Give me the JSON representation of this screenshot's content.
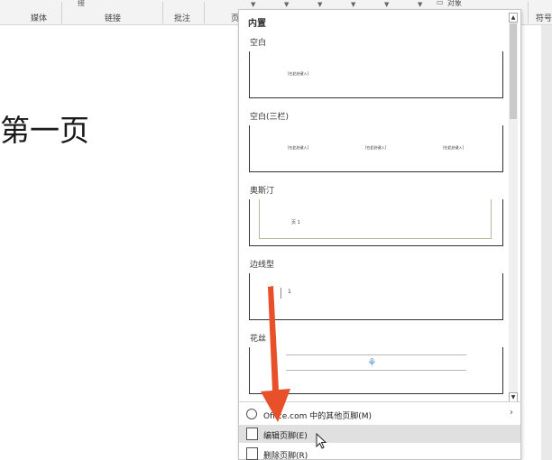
{
  "ribbon": {
    "groups": [
      "媒体",
      "链接",
      "批注",
      "页"
    ],
    "right_label": "符号",
    "fragment_left": "接",
    "fragment_right": "对象"
  },
  "document": {
    "text": "第一页"
  },
  "gallery": {
    "heading": "内置",
    "items": [
      {
        "label": "空白",
        "placeholders": [
          "[在此处键入]"
        ]
      },
      {
        "label": "空白(三栏)",
        "placeholders": [
          "[在此处键入]",
          "[在此处键入]",
          "[在此处键入]"
        ]
      },
      {
        "label": "奥斯汀",
        "page_number": "页 1"
      },
      {
        "label": "边线型",
        "page_number": "1"
      },
      {
        "label": "花丝"
      }
    ]
  },
  "commands": {
    "office": "Office.com 中的其他页脚(M)",
    "edit": "编辑页脚(E)",
    "remove": "删除页脚(R)"
  },
  "colors": {
    "annotation_arrow": "#e8502a",
    "hover": "#e0e0e0",
    "flourish": "#5b9bd5"
  }
}
